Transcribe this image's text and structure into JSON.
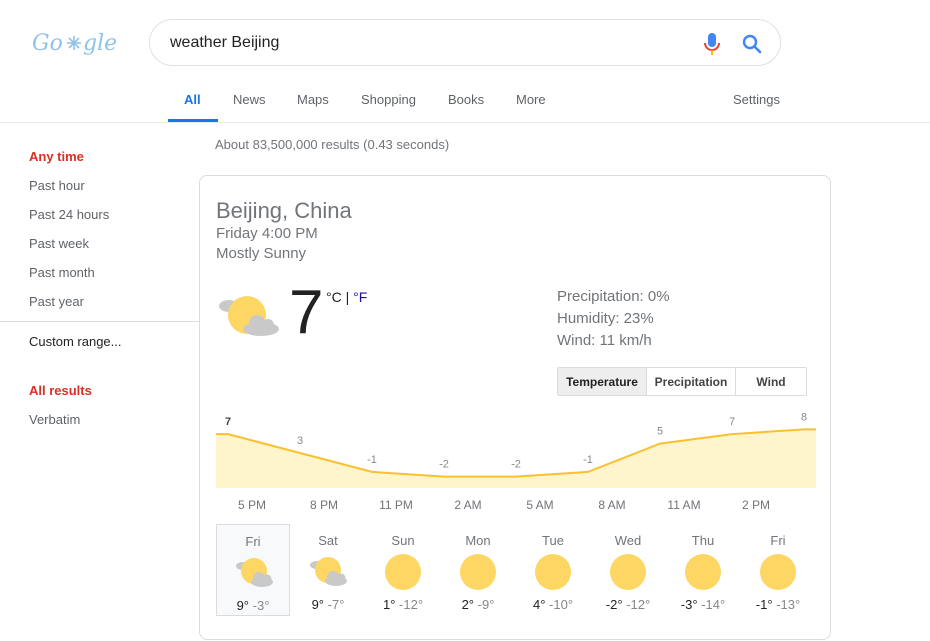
{
  "logo_text": "Google",
  "search": {
    "query": "weather Beijing"
  },
  "tabs": [
    "All",
    "News",
    "Maps",
    "Shopping",
    "Books",
    "More"
  ],
  "settings_label": "Settings",
  "sidebar": {
    "any_time": "Any time",
    "time_options": [
      "Past hour",
      "Past 24 hours",
      "Past week",
      "Past month",
      "Past year"
    ],
    "custom_range": "Custom range...",
    "all_results": "All results",
    "verbatim": "Verbatim"
  },
  "result_stats": "About 83,500,000 results (0.43 seconds)",
  "weather": {
    "location": "Beijing, China",
    "datetime": "Friday 4:00 PM",
    "condition": "Mostly Sunny",
    "temperature": "7",
    "unit_celsius": "°C",
    "unit_sep": " | ",
    "unit_fahrenheit": "°F",
    "precipitation": "Precipitation: 0%",
    "humidity": "Humidity: 23%",
    "wind": "Wind: 11 km/h",
    "segments": [
      "Temperature",
      "Precipitation",
      "Wind"
    ],
    "active_segment": 0,
    "icon": "partly-sunny-icon",
    "colors": {
      "line": "#fbc02d",
      "fill": "#fef5cc",
      "sun": "#fdd663",
      "cloud": "#c9c9c9"
    }
  },
  "chart_data": {
    "type": "area",
    "x": [
      "5 PM",
      "8 PM",
      "11 PM",
      "2 AM",
      "5 AM",
      "8 AM",
      "11 AM",
      "2 PM"
    ],
    "series": [
      {
        "values": [
          7,
          3,
          -1,
          -2,
          -2,
          -1,
          5,
          7,
          8
        ],
        "point_labels": [
          "7",
          "3",
          "-1",
          "-2",
          "-2",
          "-1",
          "5",
          "7",
          "8"
        ]
      }
    ],
    "ylim": [
      -4,
      10
    ],
    "grid": false
  },
  "forecast": [
    {
      "day": "Fri",
      "hi": "9°",
      "lo": "-3°",
      "icon": "partly-sunny-icon",
      "selected": true
    },
    {
      "day": "Sat",
      "hi": "9°",
      "lo": "-7°",
      "icon": "partly-sunny-icon",
      "selected": false
    },
    {
      "day": "Sun",
      "hi": "1°",
      "lo": "-12°",
      "icon": "sun-icon",
      "selected": false
    },
    {
      "day": "Mon",
      "hi": "2°",
      "lo": "-9°",
      "icon": "sun-icon",
      "selected": false
    },
    {
      "day": "Tue",
      "hi": "4°",
      "lo": "-10°",
      "icon": "sun-icon",
      "selected": false
    },
    {
      "day": "Wed",
      "hi": "-2°",
      "lo": "-12°",
      "icon": "sun-icon",
      "selected": false
    },
    {
      "day": "Thu",
      "hi": "-3°",
      "lo": "-14°",
      "icon": "sun-icon",
      "selected": false
    },
    {
      "day": "Fri",
      "hi": "-1°",
      "lo": "-13°",
      "icon": "sun-icon",
      "selected": false
    }
  ]
}
